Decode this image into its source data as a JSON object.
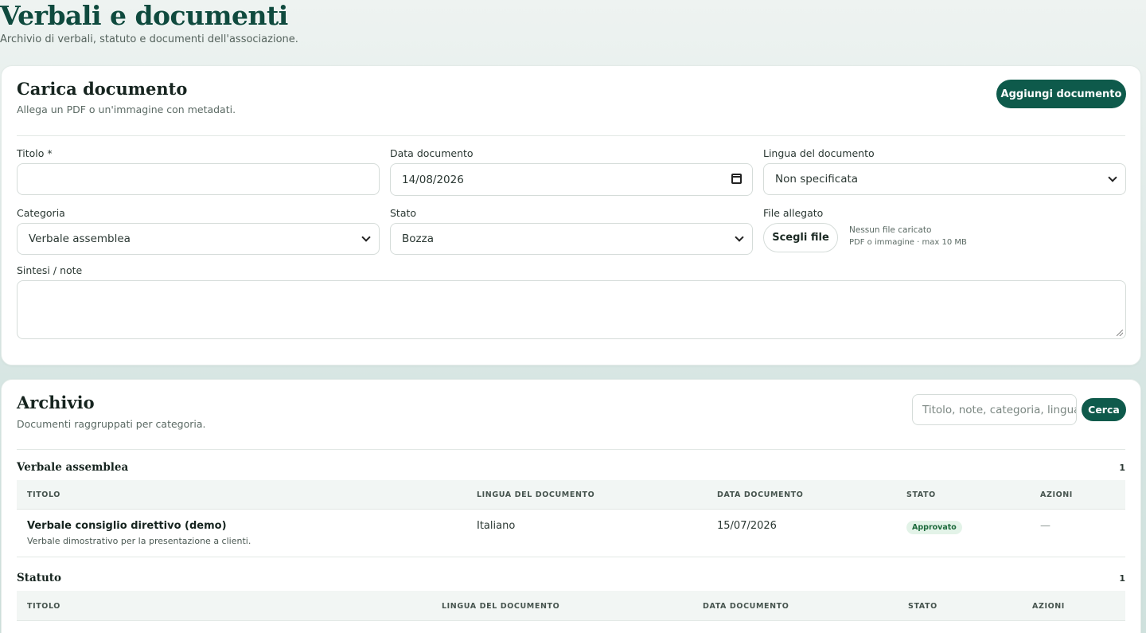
{
  "header": {
    "title": "Verbali e documenti",
    "subtitle": "Archivio di verbali, statuto e documenti dell'associazione."
  },
  "upload": {
    "title": "Carica documento",
    "description": "Allega un PDF o un'immagine con metadati.",
    "add_button": "Aggiungi documento",
    "fields": {
      "titolo_label": "Titolo *",
      "titolo_value": "",
      "data_label": "Data documento",
      "data_value": "14/08/2026",
      "lingua_label": "Lingua del documento",
      "lingua_value": "Non specificata",
      "categoria_label": "Categoria",
      "categoria_value": "Verbale assemblea",
      "stato_label": "Stato",
      "stato_value": "Bozza",
      "file_label": "File allegato",
      "file_button": "Scegli file",
      "file_status": "Nessun file caricato",
      "file_hint": "PDF o immagine · max 10 MB",
      "sintesi_label": "Sintesi / note",
      "sintesi_value": ""
    }
  },
  "archive": {
    "title": "Archivio",
    "description": "Documenti raggruppati per categoria.",
    "search_placeholder": "Titolo, note, categoria, lingua",
    "search_button": "Cerca",
    "columns": {
      "titolo": "TITOLO",
      "lingua": "LINGUA DEL DOCUMENTO",
      "data": "DATA DOCUMENTO",
      "stato": "STATO",
      "azioni": "AZIONI"
    },
    "groups": [
      {
        "name": "Verbale assemblea",
        "count": "1",
        "rows": [
          {
            "title": "Verbale consiglio direttivo (demo)",
            "description": "Verbale dimostrativo per la presentazione a clienti.",
            "lingua": "Italiano",
            "data": "15/07/2026",
            "stato": "Approvato",
            "azioni": "—"
          }
        ]
      },
      {
        "name": "Statuto",
        "count": "1",
        "rows": []
      }
    ]
  },
  "colors": {
    "primary": "#0e5a4b",
    "title": "#0f4a3e",
    "badge_bg": "#e3f3e8",
    "badge_text": "#1d6a3c"
  }
}
